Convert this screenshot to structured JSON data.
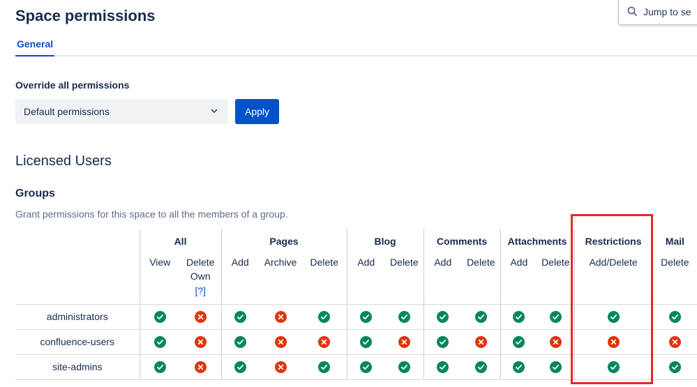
{
  "page": {
    "title": "Space permissions"
  },
  "search": {
    "icon": "search-icon",
    "text": "Jump to se"
  },
  "tabs": [
    {
      "label": "General",
      "active": true
    }
  ],
  "override": {
    "label": "Override all permissions",
    "dropdown_value": "Default permissions",
    "apply_label": "Apply"
  },
  "sections": {
    "licensed_users": "Licensed Users",
    "groups": "Groups",
    "groups_description": "Grant permissions for this space to all the members of a group."
  },
  "table": {
    "groups": [
      {
        "label": "All",
        "span": 2
      },
      {
        "label": "Pages",
        "span": 3
      },
      {
        "label": "Blog",
        "span": 2
      },
      {
        "label": "Comments",
        "span": 2
      },
      {
        "label": "Attachments",
        "span": 2
      },
      {
        "label": "Restrictions",
        "span": 1
      },
      {
        "label": "Mail",
        "span": 1
      }
    ],
    "sub_headers": [
      "View",
      "Delete Own",
      "Add",
      "Archive",
      "Delete",
      "Add",
      "Delete",
      "Add",
      "Delete",
      "Add",
      "Delete",
      "Add/Delete",
      "Delete"
    ],
    "delete_own_help": "[?]",
    "rows": [
      {
        "name": "administrators",
        "perms": [
          true,
          false,
          true,
          false,
          true,
          true,
          true,
          true,
          true,
          true,
          true,
          true,
          true
        ]
      },
      {
        "name": "confluence-users",
        "perms": [
          true,
          false,
          true,
          false,
          false,
          true,
          false,
          true,
          false,
          true,
          false,
          false,
          false
        ]
      },
      {
        "name": "site-admins",
        "perms": [
          true,
          false,
          true,
          false,
          true,
          true,
          true,
          true,
          true,
          true,
          true,
          true,
          true
        ]
      }
    ]
  },
  "icons": {
    "granted": "check-circle-icon",
    "denied": "cross-circle-icon"
  },
  "colors": {
    "granted": "#00875a",
    "denied": "#de350b",
    "accent": "#0052cc",
    "highlight": "#e02b20"
  }
}
